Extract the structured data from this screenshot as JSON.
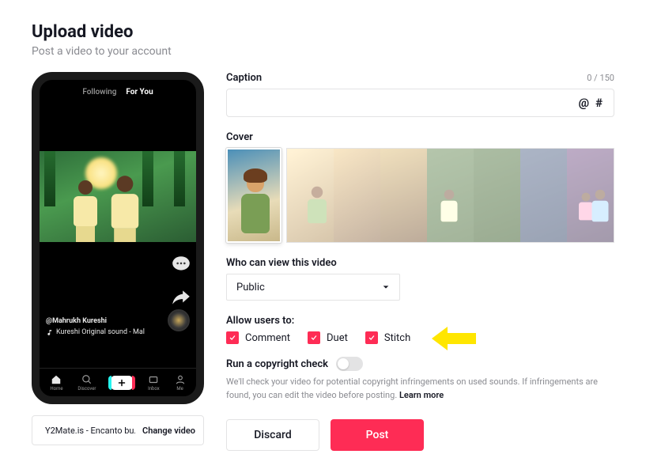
{
  "header": {
    "title": "Upload video",
    "subtitle": "Post a video to your account"
  },
  "phone": {
    "tabs": {
      "following": "Following",
      "foryou": "For You"
    },
    "user": "@Mahrukh Kureshi",
    "sound": "Kureshi Original sound - Mal",
    "nav": {
      "home": "Home",
      "discover": "Discover",
      "inbox": "Inbox",
      "me": "Me"
    }
  },
  "file": {
    "name": "Y2Mate.is - Encanto bu...",
    "change": "Change video"
  },
  "caption": {
    "label": "Caption",
    "counter": "0 / 150",
    "at": "@",
    "hash": "#"
  },
  "cover": {
    "label": "Cover"
  },
  "privacy": {
    "label": "Who can view this video",
    "value": "Public"
  },
  "allow": {
    "label": "Allow users to:",
    "comment": "Comment",
    "duet": "Duet",
    "stitch": "Stitch"
  },
  "copyright": {
    "label": "Run a copyright check",
    "helper_a": "We'll check your video for potential copyright infringements on used sounds. If infringements are found, you can edit the video before posting. ",
    "learn": "Learn more"
  },
  "buttons": {
    "discard": "Discard",
    "post": "Post"
  }
}
